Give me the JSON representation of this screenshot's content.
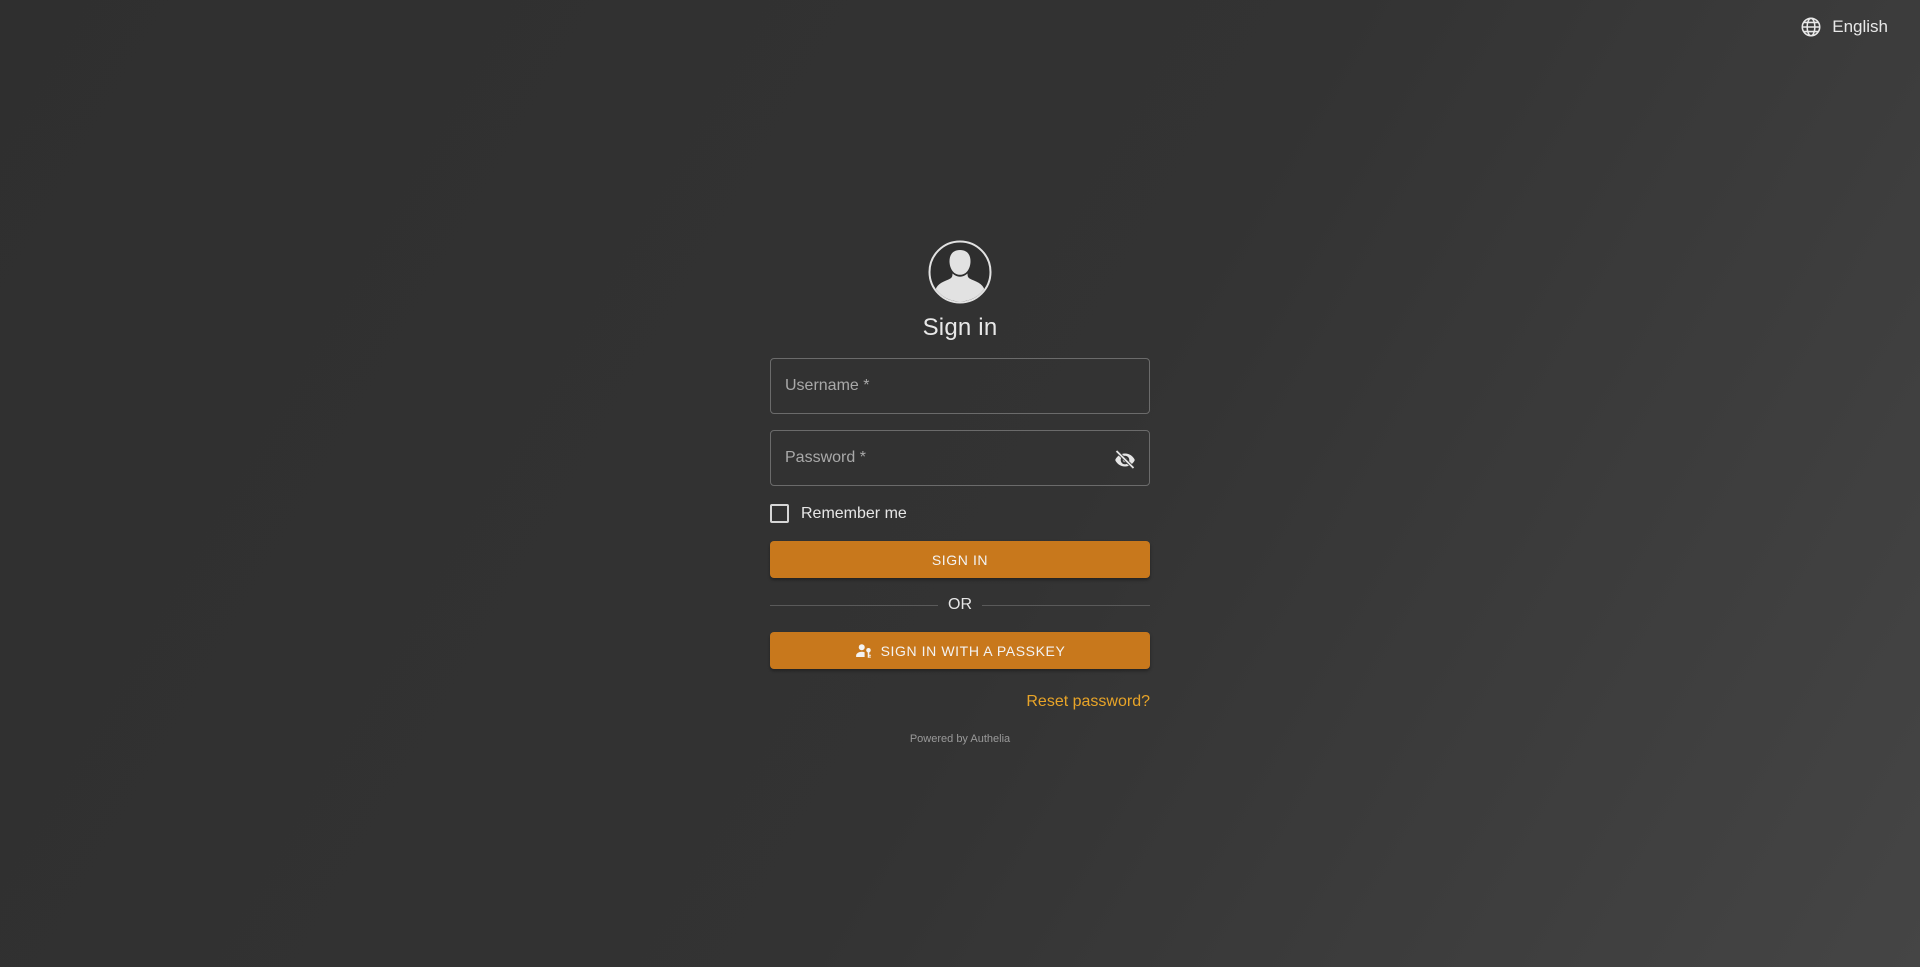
{
  "header": {
    "language_label": "English",
    "language_icon": "globe-icon"
  },
  "login": {
    "avatar_icon": "user-avatar-icon",
    "title": "Sign in",
    "username": {
      "value": "",
      "placeholder": "Username *"
    },
    "password": {
      "value": "",
      "placeholder": "Password *",
      "toggle_icon": "eye-off-icon"
    },
    "remember_label": "Remember me",
    "remember_checked": false,
    "sign_in_label": "SIGN IN",
    "divider_label": "OR",
    "passkey_label": "SIGN IN WITH A PASSKEY",
    "passkey_icon": "user-key-icon",
    "reset_label": "Reset password?",
    "powered_by": "Powered by Authelia"
  },
  "colors": {
    "accent": "#c8781c",
    "link": "#e8a428",
    "background": "#333333"
  }
}
